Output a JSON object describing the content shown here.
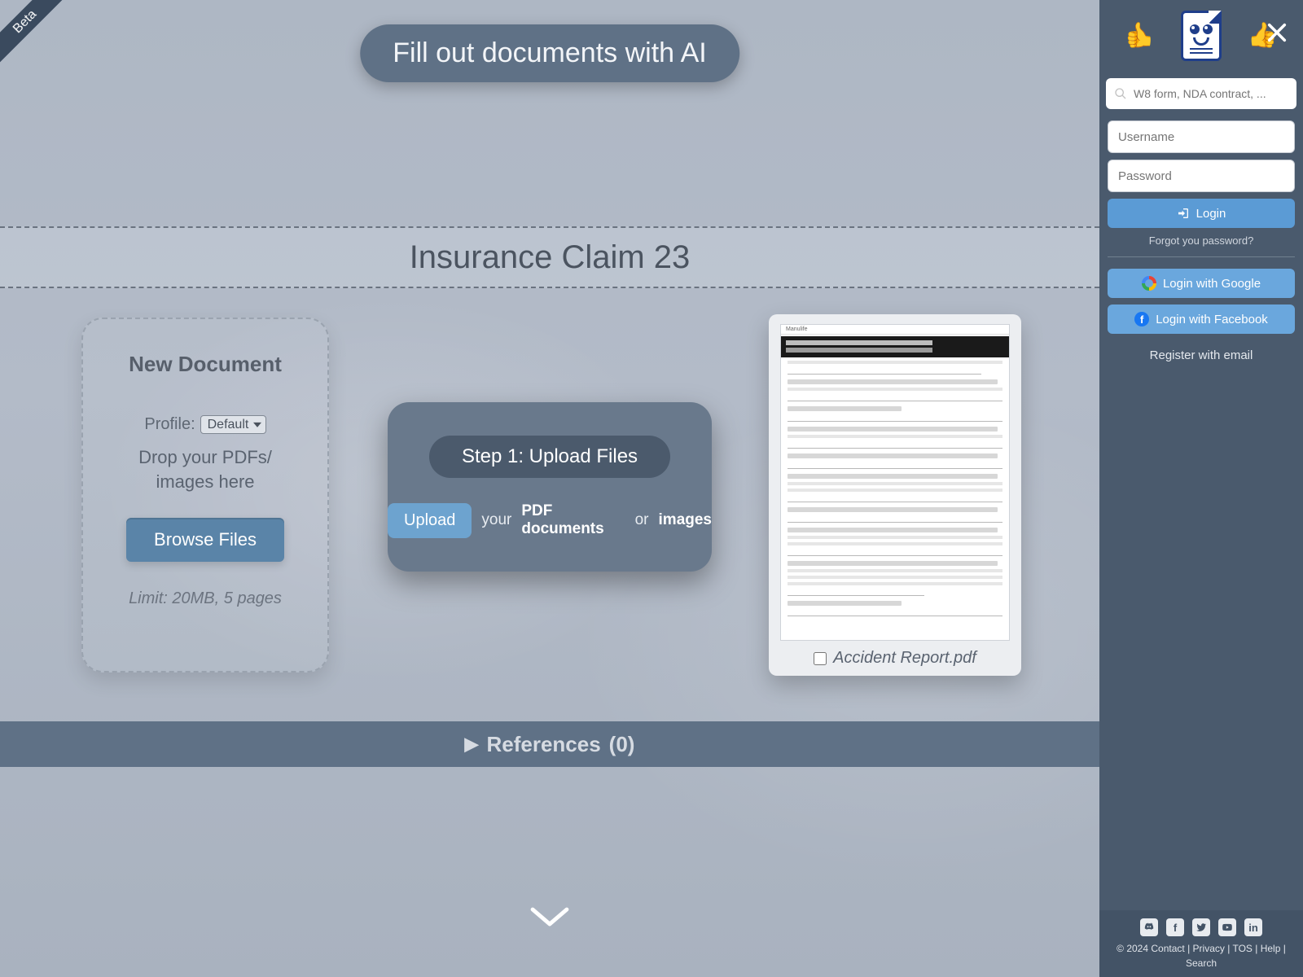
{
  "ribbon": "Beta",
  "hero": "Fill out documents with AI",
  "page_title": "Insurance Claim 23",
  "new_doc": {
    "heading": "New Document",
    "profile_label": "Profile:",
    "profile_selected": "Default",
    "drop_text_1": "Drop your PDFs/",
    "drop_text_2": "images here",
    "browse": "Browse Files",
    "limit": "Limit: 20MB, 5 pages"
  },
  "step": {
    "title": "Step 1: Upload Files",
    "upload": "Upload",
    "text_your": "your",
    "text_pdf": "PDF documents",
    "text_or": "or",
    "text_images": "images"
  },
  "doc_thumb": {
    "brand": "Manulife",
    "filename": "Accident Report.pdf"
  },
  "references": {
    "label": "References",
    "count": "(0)"
  },
  "sidebar": {
    "search_placeholder": "W8 form, NDA contract, ...",
    "username_placeholder": "Username",
    "password_placeholder": "Password",
    "login": "Login",
    "forgot": "Forgot you password?",
    "google": "Login with Google",
    "facebook": "Login with Facebook",
    "register": "Register with email"
  },
  "footer": {
    "copyright": "© 2024",
    "links": [
      "Contact",
      "Privacy",
      "TOS",
      "Help",
      "Search"
    ]
  },
  "socials": [
    "discord",
    "facebook",
    "twitter",
    "youtube",
    "linkedin"
  ]
}
